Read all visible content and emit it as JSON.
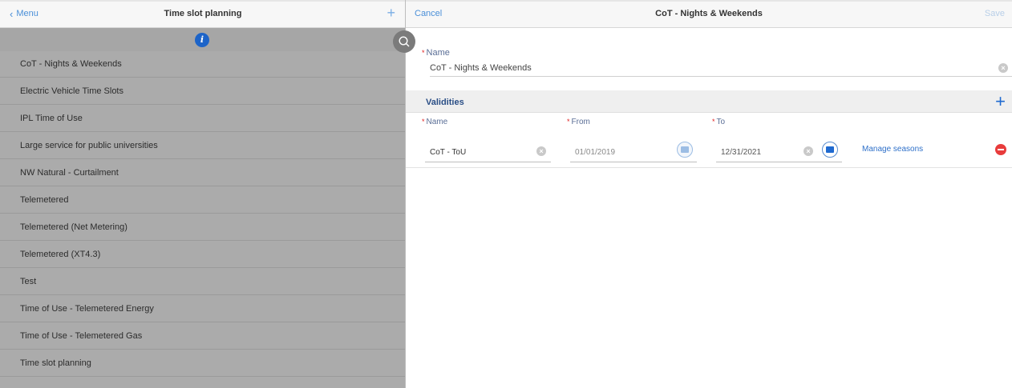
{
  "left_panel": {
    "menu_label": "Menu",
    "title": "Time slot planning",
    "add_icon": "plus-icon",
    "info_glyph": "i",
    "items": [
      "CoT - Nights & Weekends",
      "Electric Vehicle Time Slots",
      "IPL Time of Use",
      "Large service for public universities",
      "NW Natural - Curtailment",
      "Telemetered",
      "Telemetered (Net Metering)",
      "Telemetered (XT4.3)",
      "Test",
      "Time of Use - Telemetered Energy",
      "Time of Use - Telemetered Gas",
      "Time slot planning"
    ]
  },
  "right_panel": {
    "cancel_label": "Cancel",
    "title": "CoT - Nights & Weekends",
    "save_label": "Save",
    "name_field": {
      "label": "Name",
      "value": "CoT - Nights & Weekends"
    },
    "validities": {
      "title": "Validities",
      "columns": {
        "name": "Name",
        "from": "From",
        "to": "To"
      },
      "rows": [
        {
          "name": "CoT - ToU",
          "from": "01/01/2019",
          "to": "12/31/2021",
          "action_label": "Manage seasons"
        }
      ]
    }
  },
  "colors": {
    "accent": "#1f6ad0",
    "link": "#4a8fd8",
    "required": "#e02020",
    "remove": "#e83c3c",
    "list_bg": "#ababab"
  }
}
